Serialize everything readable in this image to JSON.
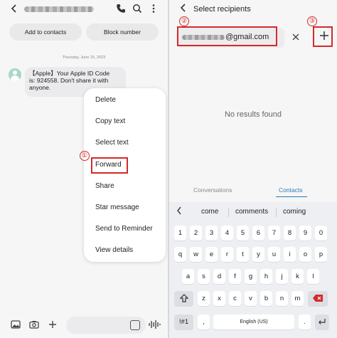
{
  "left": {
    "header": {
      "back_icon": "chevron-left-icon",
      "call_icon": "phone-icon",
      "search_icon": "search-icon",
      "more_icon": "more-vertical-icon"
    },
    "actions": {
      "add_contact": "Add to contacts",
      "block_number": "Block number"
    },
    "date": "Thursday, June 15, 2023",
    "message": {
      "line1": "【Apple】Your Apple ID Code",
      "line2": "is: 924558. Don't share it with",
      "line3": "anyone."
    },
    "context_menu": {
      "items": [
        "Delete",
        "Copy text",
        "Select text",
        "Forward",
        "Share",
        "Star message",
        "Send to Reminder",
        "View details"
      ],
      "highlighted": "Forward",
      "step_marker": "①"
    },
    "bottom_bar": {
      "icons": [
        "gallery-icon",
        "camera-icon",
        "plus-icon",
        "sticker-icon",
        "voice-icon"
      ]
    }
  },
  "right": {
    "header": {
      "back_icon": "chevron-left-icon",
      "title": "Select recipients"
    },
    "recipient": {
      "value_suffix": "@gmail.com",
      "step_marker": "②"
    },
    "clear_icon": "close-icon",
    "add": {
      "icon": "plus-icon",
      "step_marker": "③"
    },
    "empty_message": "No results found",
    "tabs": {
      "conversations": "Conversations",
      "contacts": "Contacts",
      "active": "Contacts"
    },
    "keyboard": {
      "suggestions": [
        "come",
        "comments",
        "coming"
      ],
      "number_row": [
        "1",
        "2",
        "3",
        "4",
        "5",
        "6",
        "7",
        "8",
        "9",
        "0"
      ],
      "row1": [
        "q",
        "w",
        "e",
        "r",
        "t",
        "y",
        "u",
        "i",
        "o",
        "p"
      ],
      "row2": [
        "a",
        "s",
        "d",
        "f",
        "g",
        "h",
        "j",
        "k",
        "l"
      ],
      "row3": [
        "z",
        "x",
        "c",
        "v",
        "b",
        "n",
        "m"
      ],
      "symbols_key": "!#1",
      "comma_key": ",",
      "space_label": "English (US)",
      "period_key": ".",
      "accent_color": "#2a7ab8",
      "highlight_color": "#d42a2a"
    }
  }
}
